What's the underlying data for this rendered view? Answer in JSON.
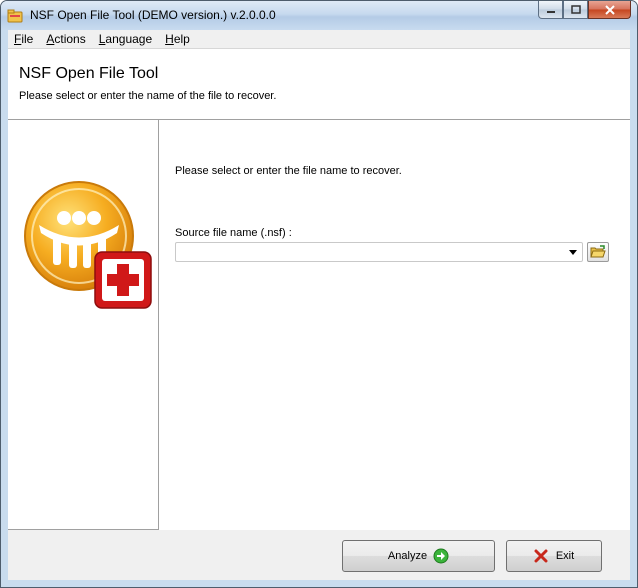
{
  "window": {
    "title": "NSF Open File Tool (DEMO version.) v.2.0.0.0",
    "app_icon": "folder-app-icon",
    "caption_buttons": [
      "minimize-icon",
      "maximize-icon",
      "close-icon"
    ]
  },
  "menu": [
    {
      "label": "File",
      "accel": "F",
      "rest": "ile"
    },
    {
      "label": "Actions",
      "accel": "A",
      "rest": "ctions"
    },
    {
      "label": "Language",
      "accel": "L",
      "rest": "anguage"
    },
    {
      "label": "Help",
      "accel": "H",
      "rest": "elp"
    }
  ],
  "header": {
    "title": "NSF Open File Tool",
    "subtitle": "Please select or enter the name of the file to recover."
  },
  "logo": {
    "icon": "lotus-notes-repair-icon",
    "colors": {
      "orange": "#f3a21b",
      "red": "#e02020"
    }
  },
  "main": {
    "prompt": "Please select or enter the file name to recover.",
    "source_label": "Source file name (.nsf) :",
    "source_value": "",
    "browse_icon": "open-folder-icon"
  },
  "footer": {
    "analyze_label": "Analyze",
    "analyze_icon": "green-arrow-right-icon",
    "exit_label": "Exit",
    "exit_icon": "red-x-icon"
  }
}
